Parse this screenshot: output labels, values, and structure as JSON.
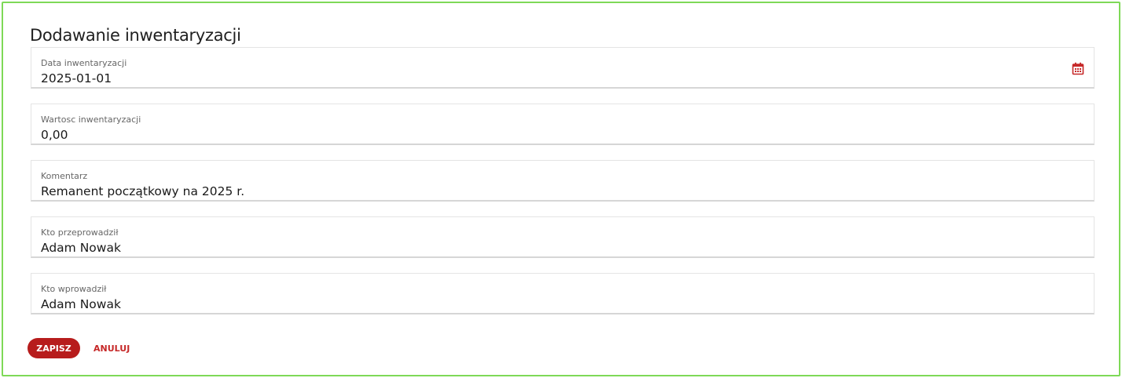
{
  "form": {
    "title": "Dodawanie inwentaryzacji",
    "fields": [
      {
        "label": "Data inwentaryzacji",
        "value": "2025-01-01",
        "icon": "calendar-icon"
      },
      {
        "label": "Wartosc inwentaryzacji",
        "value": "0,00"
      },
      {
        "label": "Komentarz",
        "value": "Remanent początkowy na 2025 r."
      },
      {
        "label": "Kto przeprowadził",
        "value": "Adam Nowak"
      },
      {
        "label": "Kto wprowadził",
        "value": "Adam Nowak"
      }
    ]
  },
  "actions": {
    "save_label": "ZAPISZ",
    "cancel_label": "ANULUJ"
  },
  "colors": {
    "frame_border": "#7ed957",
    "accent": "#b71c1c",
    "cancel_text": "#c62828"
  }
}
